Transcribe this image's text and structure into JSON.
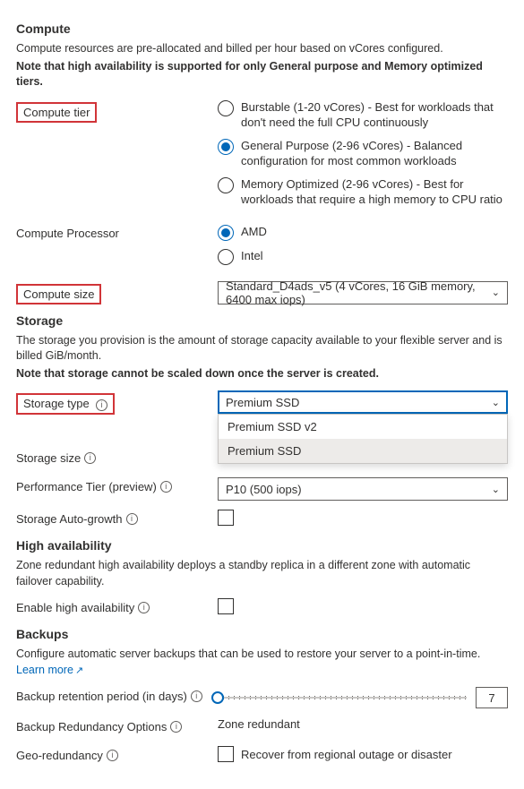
{
  "compute": {
    "heading": "Compute",
    "desc1": "Compute resources are pre-allocated and billed per hour based on vCores configured.",
    "desc2": "Note that high availability is supported for only General purpose and Memory optimized tiers.",
    "tier_label": "Compute tier",
    "tiers": {
      "burstable": "Burstable (1-20 vCores) - Best for workloads that don't need the full CPU continuously",
      "general": "General Purpose (2-96 vCores) - Balanced configuration for most common workloads",
      "memory": "Memory Optimized (2-96 vCores) - Best for workloads that require a high memory to CPU ratio"
    },
    "processor_label": "Compute Processor",
    "processors": {
      "amd": "AMD",
      "intel": "Intel"
    },
    "size_label": "Compute size",
    "size_value": "Standard_D4ads_v5 (4 vCores, 16 GiB memory, 6400 max iops)"
  },
  "storage": {
    "heading": "Storage",
    "desc1": "The storage you provision is the amount of storage capacity available to your flexible server and is billed GiB/month.",
    "desc2": "Note that storage cannot be scaled down once the server is created.",
    "type_label": "Storage type",
    "type_value": "Premium SSD",
    "type_options": [
      "Premium SSD v2",
      "Premium SSD"
    ],
    "size_label": "Storage size",
    "perf_label": "Performance Tier (preview)",
    "perf_value": "P10 (500 iops)",
    "auto_label": "Storage Auto-growth"
  },
  "ha": {
    "heading": "High availability",
    "desc": "Zone redundant high availability deploys a standby replica in a different zone with automatic failover capability.",
    "enable_label": "Enable high availability"
  },
  "backups": {
    "heading": "Backups",
    "desc": "Configure automatic server backups that can be used to restore your server to a point-in-time.",
    "learn": "Learn more",
    "retention_label": "Backup retention period (in days)",
    "retention_value": "7",
    "redundancy_label": "Backup Redundancy Options",
    "redundancy_value": "Zone redundant",
    "geo_label": "Geo-redundancy",
    "geo_check_label": "Recover from regional outage or disaster"
  }
}
